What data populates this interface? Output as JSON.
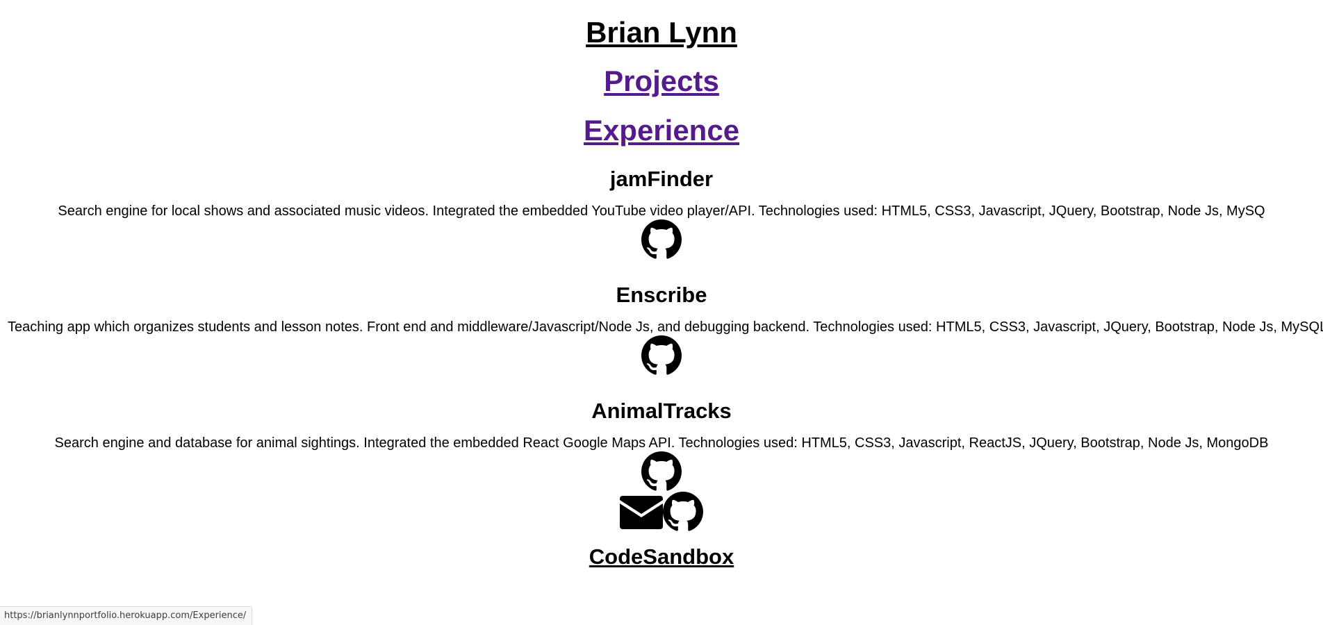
{
  "header": {
    "name": "Brian Lynn"
  },
  "nav": {
    "projects": "Projects",
    "experience": "Experience"
  },
  "projects": [
    {
      "title": "jamFinder",
      "description": "Search engine for local shows and associated music videos. Integrated the embedded YouTube video player/API. Technologies used: HTML5, CSS3, Javascript, JQuery, Bootstrap, Node Js, MySQ",
      "icon": "github-icon"
    },
    {
      "title": "Enscribe",
      "description": "Teaching app which organizes students and lesson notes. Front end and middleware/Javascript/Node Js, and debugging backend. Technologies used: HTML5, CSS3, Javascript, JQuery, Bootstrap, Node Js, MySQL",
      "icon": "github-icon"
    },
    {
      "title": "AnimalTracks",
      "description": "Search engine and database for animal sightings. Integrated the embedded React Google Maps API. Technologies used: HTML5, CSS3, Javascript, ReactJS, JQuery, Bootstrap, Node Js, MongoDB",
      "icon": "github-icon"
    }
  ],
  "contact": {
    "icons": [
      "envelope-icon",
      "github-icon"
    ]
  },
  "footer": {
    "codesandbox": "CodeSandbox"
  },
  "status_bar": {
    "url": "https://brianlynnportfolio.herokuapp.com/Experience/"
  }
}
